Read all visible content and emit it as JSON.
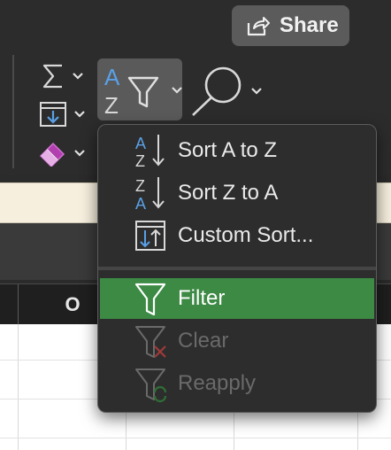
{
  "toolbar": {
    "share_label": "Share"
  },
  "sheet": {
    "column_label": "O"
  },
  "sort_filter_menu": {
    "items": [
      {
        "label": "Sort A to Z",
        "icon": "sort-ascending-icon",
        "enabled": true,
        "highlighted": false
      },
      {
        "label": "Sort Z to A",
        "icon": "sort-descending-icon",
        "enabled": true,
        "highlighted": false
      },
      {
        "label": "Custom Sort...",
        "icon": "custom-sort-icon",
        "enabled": true,
        "highlighted": false
      },
      {
        "label": "Filter",
        "icon": "filter-icon",
        "enabled": true,
        "highlighted": true
      },
      {
        "label": "Clear",
        "icon": "clear-filter-icon",
        "enabled": false,
        "highlighted": false
      },
      {
        "label": "Reapply",
        "icon": "reapply-filter-icon",
        "enabled": false,
        "highlighted": false
      }
    ]
  },
  "colors": {
    "highlight": "#3c8a44",
    "accent_blue": "#5aa0e6",
    "disabled_text": "#6a6a6a"
  }
}
